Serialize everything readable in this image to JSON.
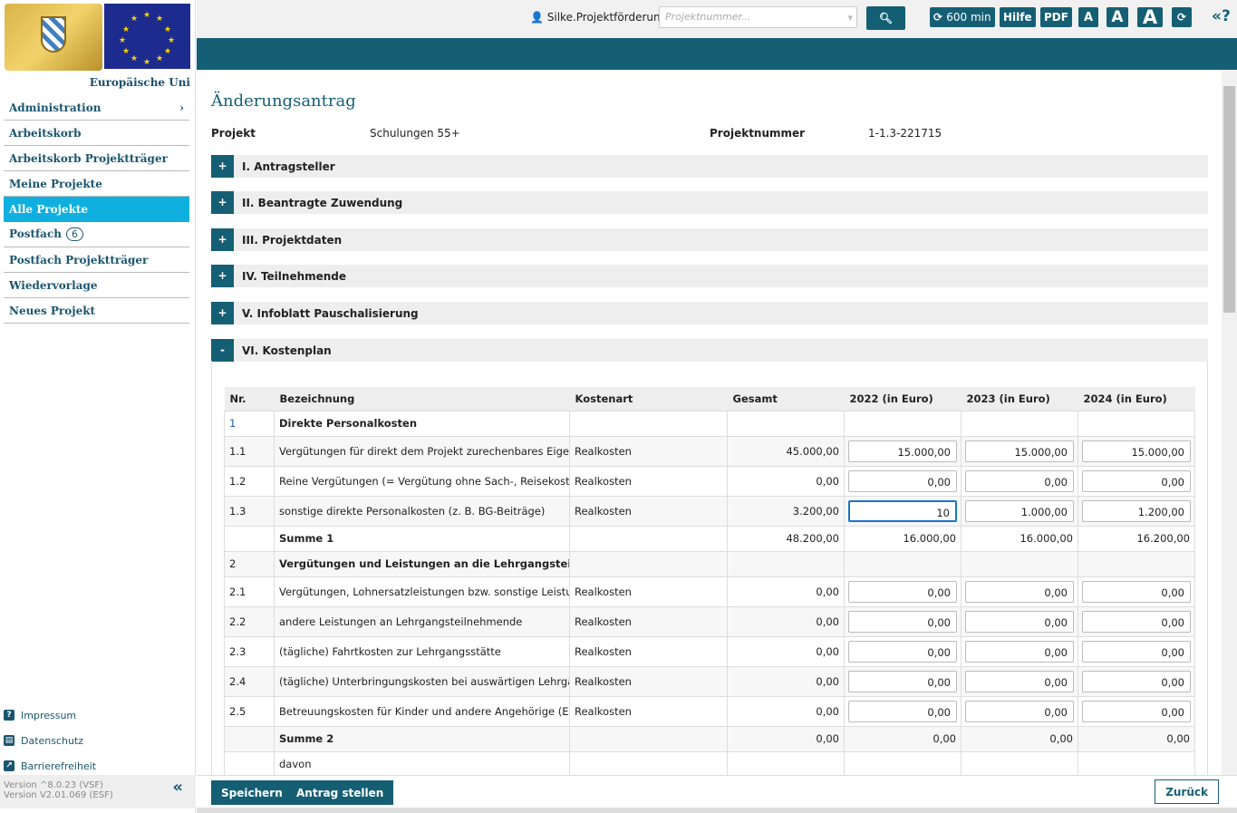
{
  "sidebar": {
    "eu_label": "Europäische Uni",
    "items": [
      {
        "label": "Administration",
        "chevron": "›"
      },
      {
        "label": "Arbeitskorb"
      },
      {
        "label": "Arbeitskorb Projektträger"
      },
      {
        "label": "Meine Projekte"
      },
      {
        "label": "Alle Projekte",
        "active": true
      },
      {
        "label": "Postfach",
        "badge": "6"
      },
      {
        "label": "Postfach Projektträger"
      },
      {
        "label": "Wiedervorlage"
      },
      {
        "label": "Neues Projekt"
      }
    ],
    "footer_links": [
      {
        "label": "Impressum",
        "icon": "question-circle-icon"
      },
      {
        "label": "Datenschutz",
        "icon": "book-icon"
      },
      {
        "label": "Barrierefreiheit",
        "icon": "external-link-icon"
      }
    ],
    "version_vsf": "Version ^8.0.23 (VSF)",
    "version_esf": "Version V2.01.069 (ESF)",
    "collapse": "«"
  },
  "topbar": {
    "user": "Silke.Projektförderung",
    "search_placeholder": "Projektnummer...",
    "timer": "600 min",
    "hilfe": "Hilfe",
    "pdf": "PDF",
    "font_small": "A",
    "font_medium": "A",
    "font_large": "A",
    "help_toggle": "«?"
  },
  "colors": {
    "primary": "#155f74",
    "active_nav": "#0fb0e0"
  },
  "main": {
    "title": "Änderungsantrag",
    "projekt_label": "Projekt",
    "projekt_value": "Schulungen 55+",
    "nr_label": "Projektnummer",
    "nr_value": "1-1.3-221715",
    "sections": [
      {
        "toggle": "+",
        "label": "I. Antragsteller"
      },
      {
        "toggle": "+",
        "label": "II. Beantragte Zuwendung"
      },
      {
        "toggle": "+",
        "label": "III. Projektdaten"
      },
      {
        "toggle": "+",
        "label": "IV. Teilnehmende"
      },
      {
        "toggle": "+",
        "label": "V. Infoblatt Pauschalisierung"
      },
      {
        "toggle": "-",
        "label": "VI. Kostenplan"
      }
    ],
    "table": {
      "headers": [
        "Nr.",
        "Bezeichnung",
        "Kostenart",
        "Gesamt",
        "2022 (in Euro)",
        "2023 (in Euro)",
        "2024 (in Euro)"
      ],
      "rows": [
        {
          "nr": "1",
          "bez": "Direkte Personalkosten",
          "art": "",
          "gesamt": "",
          "y": [
            "",
            "",
            ""
          ],
          "type": "group"
        },
        {
          "nr": "1.1",
          "bez": "Vergütungen für direkt dem Projekt zurechenbares Eigenpersonal",
          "art": "Realkosten",
          "gesamt": "45.000,00",
          "y": [
            "15.000,00",
            "15.000,00",
            "15.000,00"
          ],
          "type": "input"
        },
        {
          "nr": "1.2",
          "bez": "Reine Vergütungen (= Vergütung ohne Sach-, Reisekosten) für",
          "art": "Realkosten",
          "gesamt": "0,00",
          "y": [
            "0,00",
            "0,00",
            "0,00"
          ],
          "type": "input"
        },
        {
          "nr": "1.3",
          "bez": "sonstige direkte Personalkosten (z. B. BG-Beiträge)",
          "art": "Realkosten",
          "gesamt": "3.200,00",
          "y": [
            "10",
            "1.000,00",
            "1.200,00"
          ],
          "type": "input",
          "focus": 0
        },
        {
          "nr": "",
          "bez": "Summe 1",
          "art": "",
          "gesamt": "48.200,00",
          "y": [
            "16.000,00",
            "16.000,00",
            "16.200,00"
          ],
          "type": "sum"
        },
        {
          "nr": "2",
          "bez": "Vergütungen und Leistungen an die Lehrgangsteilnehmende",
          "art": "",
          "gesamt": "",
          "y": [
            "",
            "",
            ""
          ],
          "type": "group"
        },
        {
          "nr": "2.1",
          "bez": "Vergütungen, Lohnersatzleistungen bzw. sonstige Leistungen",
          "art": "Realkosten",
          "gesamt": "0,00",
          "y": [
            "0,00",
            "0,00",
            "0,00"
          ],
          "type": "input"
        },
        {
          "nr": "2.2",
          "bez": "andere Leistungen an Lehrgangsteilnehmende",
          "art": "Realkosten",
          "gesamt": "0,00",
          "y": [
            "0,00",
            "0,00",
            "0,00"
          ],
          "type": "input"
        },
        {
          "nr": "2.3",
          "bez": "(tägliche) Fahrtkosten zur Lehrgangsstätte",
          "art": "Realkosten",
          "gesamt": "0,00",
          "y": [
            "0,00",
            "0,00",
            "0,00"
          ],
          "type": "input"
        },
        {
          "nr": "2.4",
          "bez": "(tägliche) Unterbringungskosten bei auswärtigen Lehrgängen",
          "art": "Realkosten",
          "gesamt": "0,00",
          "y": [
            "0,00",
            "0,00",
            "0,00"
          ],
          "type": "input"
        },
        {
          "nr": "2.5",
          "bez": "Betreuungskosten für Kinder und andere Angehörige (Erstattung",
          "art": "Realkosten",
          "gesamt": "0,00",
          "y": [
            "0,00",
            "0,00",
            "0,00"
          ],
          "type": "input"
        },
        {
          "nr": "",
          "bez": "Summe 2",
          "art": "",
          "gesamt": "0,00",
          "y": [
            "0,00",
            "0,00",
            "0,00"
          ],
          "type": "sum"
        },
        {
          "nr": "",
          "bez": "davon",
          "art": "",
          "gesamt": "",
          "y": [
            "",
            "",
            ""
          ],
          "type": "plain"
        }
      ]
    }
  },
  "bottombar": {
    "save": "Speichern",
    "submit": "Antrag stellen",
    "back": "Zurück"
  }
}
